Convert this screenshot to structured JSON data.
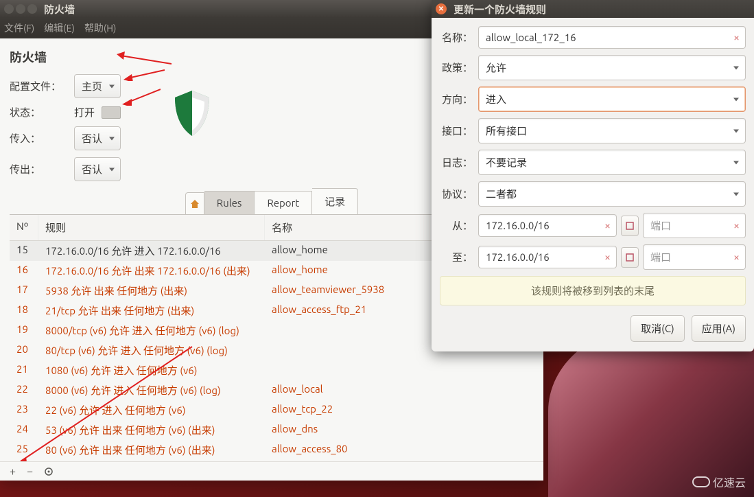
{
  "main_window": {
    "title": "防火墙",
    "menubar": {
      "file": "文件(F)",
      "edit": "编辑(E)",
      "help": "帮助(H)"
    },
    "section_title": "防火墙",
    "labels": {
      "profile": "配置文件：",
      "status": "状态：",
      "incoming": "传入：",
      "outgoing": "传出："
    },
    "values": {
      "profile": "主页",
      "status": "打开",
      "incoming": "否认",
      "outgoing": "否认"
    },
    "tabs": {
      "rules": "Rules",
      "report": "Report",
      "log": "记录"
    },
    "table_headers": {
      "no": "Nº",
      "rule": "规则",
      "name": "名称"
    },
    "rows": [
      {
        "no": "15",
        "rule": "172.16.0.0/16 允许 进入 172.16.0.0/16",
        "name": "allow_home",
        "cls": "first"
      },
      {
        "no": "16",
        "rule": "172.16.0.0/16 允许 出来 172.16.0.0/16 (出来)",
        "name": "allow_home",
        "cls": "orange"
      },
      {
        "no": "17",
        "rule": "5938 允许 出来 任何地方 (出来)",
        "name": "allow_teamviewer_5938",
        "cls": "orange"
      },
      {
        "no": "18",
        "rule": "21/tcp 允许 出来 任何地方 (出来)",
        "name": "allow_access_ftp_21",
        "cls": "orange"
      },
      {
        "no": "19",
        "rule": "8000/tcp (v6) 允许 进入 任何地方 (v6) (log)",
        "name": "",
        "cls": "orange"
      },
      {
        "no": "20",
        "rule": "80/tcp (v6) 允许 进入 任何地方 (v6) (log)",
        "name": "",
        "cls": "orange"
      },
      {
        "no": "21",
        "rule": "1080 (v6) 允许 进入 任何地方 (v6)",
        "name": "",
        "cls": "orange"
      },
      {
        "no": "22",
        "rule": "8000 (v6) 允许 进入 任何地方 (v6) (log)",
        "name": "allow_local",
        "cls": "orange"
      },
      {
        "no": "23",
        "rule": "22 (v6) 允许 进入 任何地方 (v6)",
        "name": "allow_tcp_22",
        "cls": "orange"
      },
      {
        "no": "24",
        "rule": "53 (v6) 允许 出来 任何地方 (v6) (出来)",
        "name": "allow_dns",
        "cls": "orange"
      },
      {
        "no": "25",
        "rule": "80 (v6) 允许 出来 任何地方 (v6) (出来)",
        "name": "allow_access_80",
        "cls": "orange"
      }
    ],
    "bottom_toolbar": {
      "add": "+",
      "remove": "−",
      "settings": ""
    }
  },
  "dialog": {
    "title": "更新一个防火墙规则",
    "labels": {
      "name": "名称：",
      "policy": "政策：",
      "direction": "方向：",
      "interface": "接口：",
      "log": "日志：",
      "protocol": "协议：",
      "from": "从：",
      "to": "至："
    },
    "values": {
      "name": "allow_local_172_16",
      "policy": "允许",
      "direction": "进入",
      "interface": "所有接口",
      "log": "不要记录",
      "protocol": "二者都",
      "from_addr": "172.16.0.0/16",
      "from_port": "端口",
      "to_addr": "172.16.0.0/16",
      "to_port": "端口"
    },
    "notice": "该规则将被移到列表的末尾",
    "buttons": {
      "cancel": "取消(C)",
      "apply": "应用(A)"
    }
  },
  "watermark": "亿速云"
}
